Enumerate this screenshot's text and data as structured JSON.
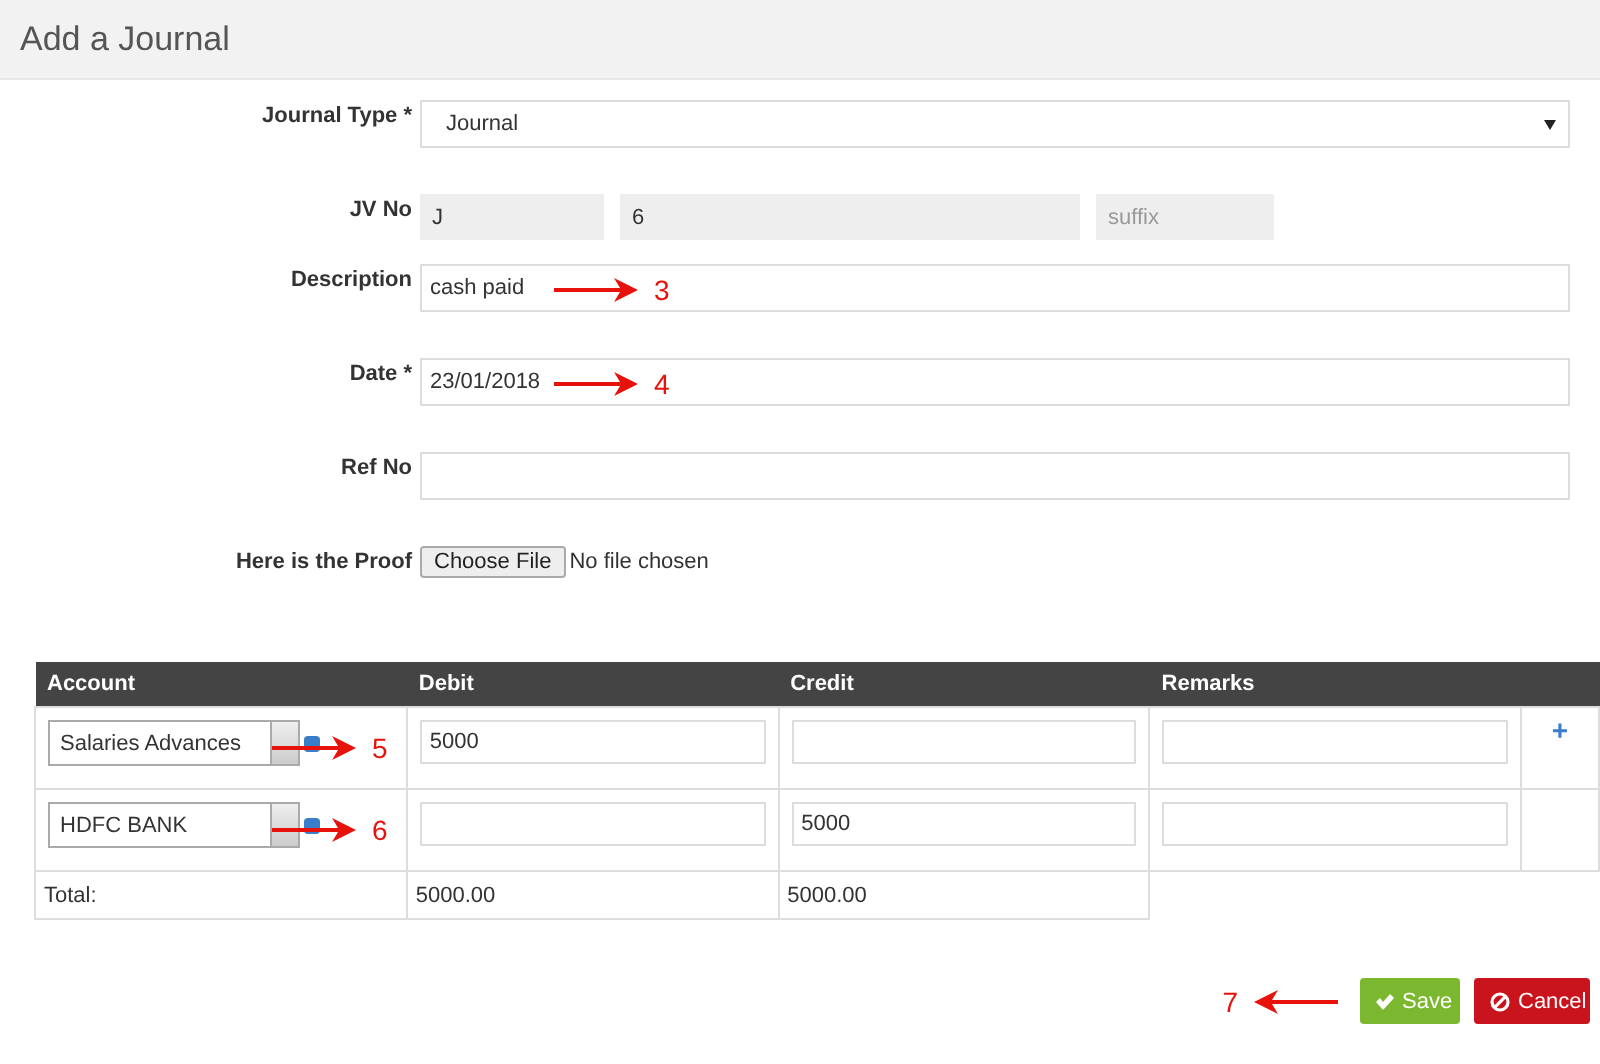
{
  "header": {
    "title": "Add a Journal"
  },
  "fields": [
    {
      "label": "Journal Type *",
      "kind": "select",
      "value": "Journal"
    },
    {
      "label": "JV No",
      "kind": "jv",
      "parts": [
        {
          "value": "J"
        },
        {
          "value": "6"
        },
        {
          "placeholder": "suffix"
        }
      ]
    },
    {
      "label": "Description",
      "kind": "text",
      "value": "cash paid",
      "annotation": "3"
    },
    {
      "label": "Date *",
      "kind": "text",
      "value": "23/01/2018",
      "annotation": "4"
    },
    {
      "label": "Ref No",
      "kind": "text"
    },
    {
      "label": "Here is the Proof",
      "kind": "file",
      "button": "Choose File",
      "status": "No file chosen"
    }
  ],
  "table": {
    "columns": [
      "Account",
      "Debit",
      "Credit",
      "Remarks"
    ],
    "rows": [
      {
        "account": "Salaries Advances",
        "debit": "5000",
        "action": "+",
        "annotation": "5"
      },
      {
        "account": "HDFC BANK",
        "credit": "5000",
        "annotation": "6"
      }
    ],
    "total": {
      "label": "Total:",
      "debit": "5000.00",
      "credit": "5000.00"
    }
  },
  "actions": {
    "annotation": "7",
    "buttons": [
      {
        "label": "Save",
        "kind": "save"
      },
      {
        "label": "Cancel",
        "kind": "cancel"
      }
    ]
  }
}
